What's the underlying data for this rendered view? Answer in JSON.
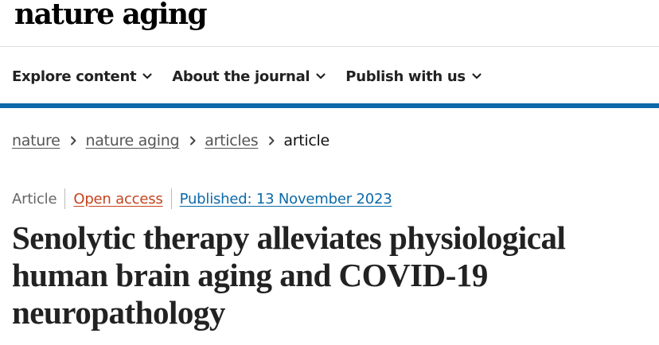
{
  "header": {
    "logo_text": "nature aging"
  },
  "nav": {
    "items": [
      {
        "label": "Explore content",
        "icon": "chevron-down-icon"
      },
      {
        "label": "About the journal",
        "icon": "chevron-down-icon"
      },
      {
        "label": "Publish with us",
        "icon": "chevron-down-icon"
      }
    ]
  },
  "breadcrumb": {
    "items": [
      "nature",
      "nature aging",
      "articles"
    ],
    "current": "article",
    "separator_icon": "chevron-right-icon"
  },
  "article": {
    "type": "Article",
    "access": "Open access",
    "published": "Published: 13 November 2023",
    "title": "Senolytic therapy alleviates physiological human brain aging and COVID-19 neuropathology"
  },
  "colors": {
    "accent_blue": "#0c6aa8",
    "open_access": "#c5431d",
    "text_dark": "#222222",
    "text_muted": "#666666"
  }
}
